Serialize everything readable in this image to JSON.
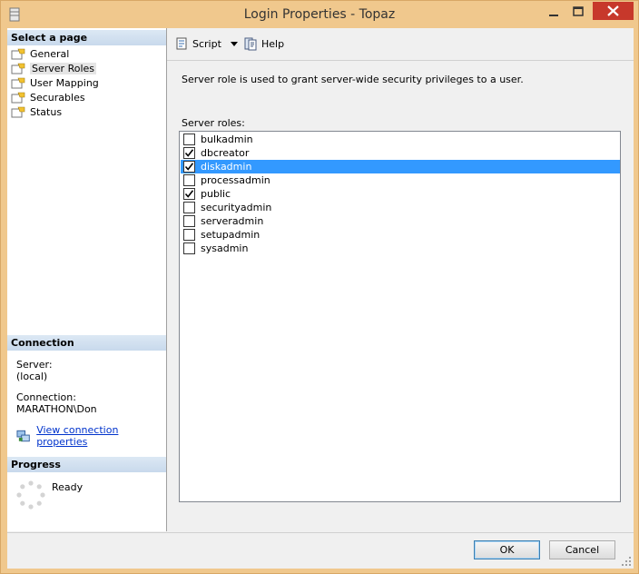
{
  "window": {
    "title": "Login Properties - Topaz"
  },
  "sidebar": {
    "header": "Select a page",
    "items": [
      {
        "label": "General"
      },
      {
        "label": "Server Roles",
        "selected": true
      },
      {
        "label": "User Mapping"
      },
      {
        "label": "Securables"
      },
      {
        "label": "Status"
      }
    ]
  },
  "connection": {
    "header": "Connection",
    "server_label": "Server:",
    "server_value": "(local)",
    "connection_label": "Connection:",
    "connection_value": "MARATHON\\Don",
    "link": "View connection properties"
  },
  "progress": {
    "header": "Progress",
    "status": "Ready"
  },
  "toolbar": {
    "script": "Script",
    "help": "Help"
  },
  "main": {
    "description": "Server role is used to grant server-wide security privileges to a user.",
    "roles_label": "Server roles:",
    "roles": [
      {
        "name": "bulkadmin",
        "checked": false
      },
      {
        "name": "dbcreator",
        "checked": true
      },
      {
        "name": "diskadmin",
        "checked": true,
        "selected": true
      },
      {
        "name": "processadmin",
        "checked": false
      },
      {
        "name": "public",
        "checked": true
      },
      {
        "name": "securityadmin",
        "checked": false
      },
      {
        "name": "serveradmin",
        "checked": false
      },
      {
        "name": "setupadmin",
        "checked": false
      },
      {
        "name": "sysadmin",
        "checked": false
      }
    ]
  },
  "footer": {
    "ok": "OK",
    "cancel": "Cancel"
  },
  "colors": {
    "selection": "#3399ff",
    "frame": "#f0c88d",
    "close": "#c7382b",
    "link": "#0033cc"
  }
}
